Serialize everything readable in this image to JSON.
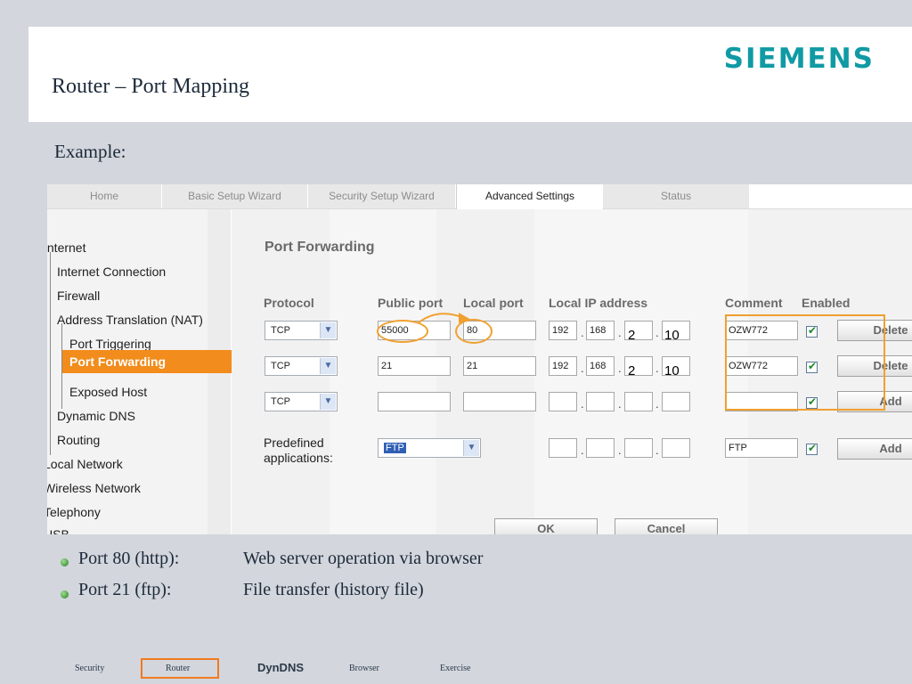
{
  "slide": {
    "title": "Router – Port Mapping",
    "brand": "SIEMENS",
    "example_label": "Example:"
  },
  "tabs": [
    {
      "label": "Home",
      "active": false
    },
    {
      "label": "Basic Setup Wizard",
      "active": false
    },
    {
      "label": "Security Setup Wizard",
      "active": false
    },
    {
      "label": "Advanced Settings",
      "active": true
    },
    {
      "label": "Status",
      "active": false
    }
  ],
  "sidebar": {
    "items": [
      {
        "label": "Internet"
      },
      {
        "label": "Internet Connection"
      },
      {
        "label": "Firewall"
      },
      {
        "label": "Address Translation (NAT)"
      },
      {
        "label": "Port Triggering"
      },
      {
        "label": "Port Forwarding",
        "active": true
      },
      {
        "label": "Exposed Host"
      },
      {
        "label": "Dynamic DNS"
      },
      {
        "label": "Routing"
      },
      {
        "label": "Local Network"
      },
      {
        "label": "Wireless Network"
      },
      {
        "label": "Telephony"
      },
      {
        "label": "USB"
      }
    ]
  },
  "main": {
    "heading": "Port Forwarding",
    "columns": {
      "protocol": "Protocol",
      "public_port": "Public port",
      "local_port": "Local port",
      "local_ip": "Local IP address",
      "comment": "Comment",
      "enabled": "Enabled"
    },
    "rows": [
      {
        "protocol": "TCP",
        "public_port": "55000",
        "local_port": "80",
        "ip": [
          "192",
          "168",
          "2",
          "10"
        ],
        "comment": "OZW772",
        "enabled": true,
        "action": "Delete"
      },
      {
        "protocol": "TCP",
        "public_port": "21",
        "local_port": "21",
        "ip": [
          "192",
          "168",
          "2",
          "10"
        ],
        "comment": "OZW772",
        "enabled": true,
        "action": "Delete"
      },
      {
        "protocol": "TCP",
        "public_port": "",
        "local_port": "",
        "ip": [
          "",
          "",
          "",
          ""
        ],
        "comment": "",
        "enabled": true,
        "action": "Add"
      }
    ],
    "predefined": {
      "label_line1": "Predefined",
      "label_line2": "applications:",
      "selected": "FTP",
      "ip": [
        "",
        "",
        "",
        ""
      ],
      "comment": "FTP",
      "enabled": true,
      "action": "Add"
    },
    "ok_label": "OK",
    "cancel_label": "Cancel"
  },
  "bullets": [
    {
      "term": "Port 80 (http):",
      "desc": "Web server operation via browser"
    },
    {
      "term": "Port 21 (ftp):",
      "desc": "File transfer (history file)"
    }
  ],
  "footer_nav": [
    {
      "label": "Security"
    },
    {
      "label": "Router",
      "highlighted": true
    },
    {
      "label": "DynDNS"
    },
    {
      "label": "Browser"
    },
    {
      "label": "Exercise"
    }
  ],
  "colors": {
    "brand": "#109aa4",
    "accent_orange": "#f28c1c",
    "highlight": "#f0a030",
    "footer_highlight": "#f07a20",
    "slide_background": "#d3d6dc"
  }
}
